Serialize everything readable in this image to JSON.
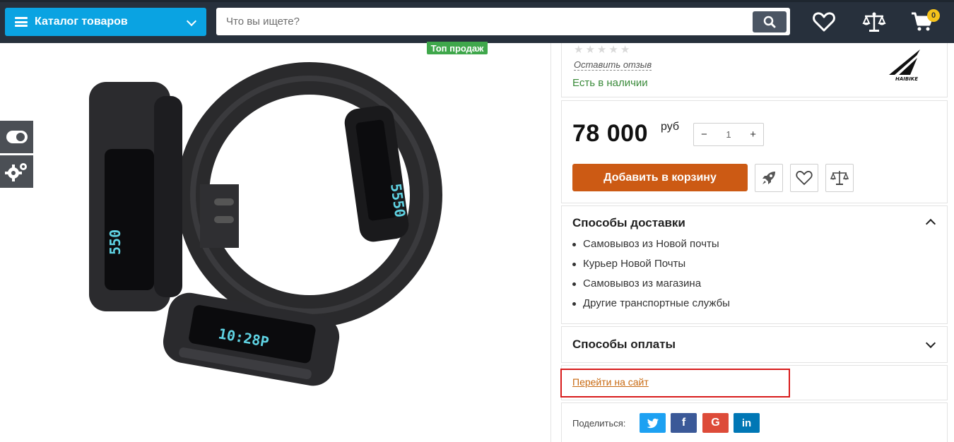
{
  "header": {
    "catalog_label": "Каталог товаров",
    "search_placeholder": "Что вы ищете?",
    "cart_count": "0"
  },
  "product": {
    "top_badge": "Топ продаж",
    "review_link": "Оставить отзыв",
    "stock_status": "Есть в наличии",
    "price": "78 000",
    "currency": "руб",
    "quantity": "1",
    "qty_minus": "−",
    "qty_plus": "+",
    "add_to_cart": "Добавить в корзину",
    "brand": "HAIBIKE"
  },
  "delivery": {
    "title": "Способы доставки",
    "items": [
      "Самовывоз из Новой почты",
      "Курьер Новой Почты",
      "Самовывоз из магазина",
      "Другие транспортные службы"
    ]
  },
  "payment": {
    "title": "Способы оплаты"
  },
  "site_link": "Перейти на сайт",
  "share": {
    "label": "Поделиться:",
    "networks": [
      {
        "name": "twitter",
        "color": "#1da1f2"
      },
      {
        "name": "facebook",
        "color": "#3b5998"
      },
      {
        "name": "google",
        "color": "#dd4b39"
      },
      {
        "name": "linkedin",
        "color": "#0077b5"
      }
    ]
  },
  "colors": {
    "header_bg": "#27303c",
    "catalog_btn": "#0aa3e2",
    "add_cart_btn": "#cc5a14",
    "badge_green": "#3fa74b",
    "highlight_red": "#d81b1b"
  }
}
